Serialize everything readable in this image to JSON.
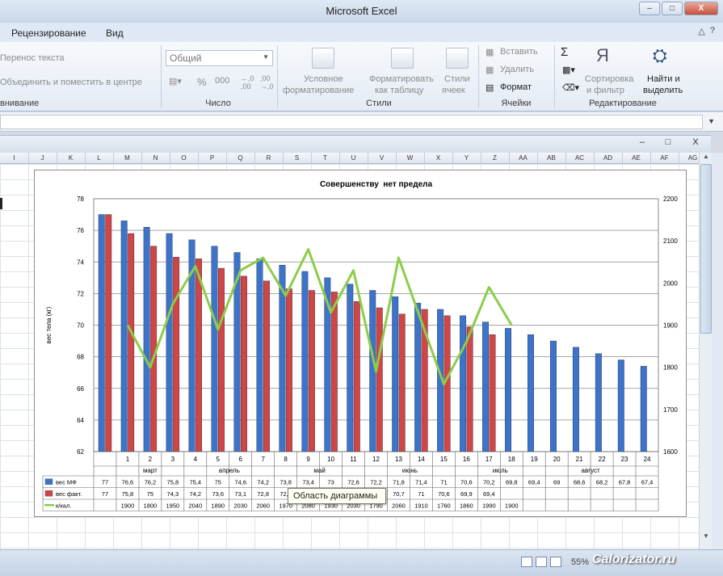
{
  "window": {
    "title": "Microsoft Excel",
    "controls": [
      "–",
      "□",
      "X"
    ]
  },
  "tabs": [
    "Рецензирование",
    "Вид"
  ],
  "help": {
    "up": "△",
    "help": "?"
  },
  "ribbon": {
    "wrap_text": "Перенос текста",
    "merge_center": "Объединить и поместить в центре",
    "align_group": "внивание",
    "number_format": "Общий",
    "number_group": "Число",
    "cond_format": [
      "Условное",
      "форматирование"
    ],
    "format_table": [
      "Форматировать",
      "как таблицу"
    ],
    "cell_styles": [
      "Стили",
      "ячеек"
    ],
    "styles_group": "Стили",
    "insert": "Вставить",
    "delete": "Удалить",
    "format": "Формат",
    "cells_group": "Ячейки",
    "sigma": "Σ",
    "sort_filter": [
      "Сортировка",
      "и фильтр"
    ],
    "find_select": [
      "Найти и",
      "выделить"
    ],
    "edit_group": "Редактирование"
  },
  "columns": [
    "I",
    "J",
    "K",
    "L",
    "M",
    "N",
    "O",
    "P",
    "Q",
    "R",
    "S",
    "T",
    "U",
    "V",
    "W",
    "X",
    "Y",
    "Z",
    "AA",
    "AB",
    "AC",
    "AD",
    "AE",
    "AF",
    "AG"
  ],
  "tooltip": "Область диаграммы",
  "status": {
    "zoom": "55%"
  },
  "watermark": "Calorizator.ru",
  "chart_data": {
    "type": "bar",
    "title": "Совершенству  нет предела",
    "ylabel": "вес тела (кг)",
    "ylim": [
      62,
      78
    ],
    "y2lim": [
      1600,
      2200
    ],
    "yticks": [
      62,
      64,
      66,
      68,
      70,
      72,
      74,
      76,
      78
    ],
    "y2ticks": [
      1600,
      1700,
      1800,
      1900,
      2000,
      2100,
      2200
    ],
    "categories": [
      "",
      "1",
      "2",
      "3",
      "4",
      "5",
      "6",
      "7",
      "8",
      "9",
      "10",
      "11",
      "12",
      "13",
      "14",
      "15",
      "16",
      "17",
      "18",
      "19",
      "20",
      "21",
      "22",
      "23",
      "24"
    ],
    "months": [
      {
        "label": "март",
        "center": 2
      },
      {
        "label": "апрель",
        "center": 5.5
      },
      {
        "label": "май",
        "center": 9.5
      },
      {
        "label": "июнь",
        "center": 13.5
      },
      {
        "label": "июль",
        "center": 17.5
      },
      {
        "label": "август",
        "center": 21.5
      }
    ],
    "grid": true,
    "series": [
      {
        "name": "вес МФ",
        "type": "bar",
        "color": "#3d73c8",
        "values": [
          77,
          76.6,
          76.2,
          75.8,
          75.4,
          75,
          74.6,
          74.2,
          73.8,
          73.4,
          73,
          72.6,
          72.2,
          71.8,
          71.4,
          71,
          70.6,
          70.2,
          69.8,
          69.4,
          69,
          68.6,
          68.2,
          67.8,
          67.4
        ]
      },
      {
        "name": "вес факт.",
        "type": "bar",
        "color": "#d04545",
        "values": [
          77,
          75.8,
          75,
          74.3,
          74.2,
          73.6,
          73.1,
          72.8,
          72.3,
          72.2,
          72.1,
          71.5,
          71.1,
          70.7,
          71,
          70.6,
          69.9,
          69.4,
          null,
          null,
          null,
          null,
          null,
          null,
          null
        ]
      },
      {
        "name": "к/кал.",
        "type": "line",
        "axis": "right",
        "color": "#8ccd4a",
        "values": [
          null,
          1900,
          1800,
          1950,
          2040,
          1890,
          2030,
          2060,
          1970,
          2080,
          1930,
          2030,
          1790,
          2060,
          1910,
          1760,
          1860,
          1990,
          1900,
          null,
          null,
          null,
          null,
          null,
          null
        ]
      }
    ],
    "table": {
      "rows": [
        [
          "77",
          "76,6",
          "76,2",
          "75,8",
          "75,4",
          "75",
          "74,6",
          "74,2",
          "73,8",
          "73,4",
          "73",
          "72,6",
          "72,2",
          "71,8",
          "71,4",
          "71",
          "70,6",
          "70,2",
          "69,8",
          "69,4",
          "69",
          "68,6",
          "68,2",
          "67,8",
          "67,4"
        ],
        [
          "77",
          "75,8",
          "75",
          "74,3",
          "74,2",
          "73,6",
          "73,1",
          "72,8",
          "72,3",
          "72,2",
          "72,1",
          "71,5",
          "71,1",
          "70,7",
          "71",
          "70,6",
          "69,9",
          "69,4",
          "",
          "",
          "",
          "",
          "",
          "",
          ""
        ],
        [
          "",
          "1900",
          "1800",
          "1950",
          "2040",
          "1890",
          "2030",
          "2060",
          "1970",
          "2080",
          "1930",
          "2030",
          "1790",
          "2060",
          "1910",
          "1760",
          "1860",
          "1990",
          "1900",
          "",
          "",
          "",
          "",
          "",
          ""
        ]
      ]
    }
  }
}
